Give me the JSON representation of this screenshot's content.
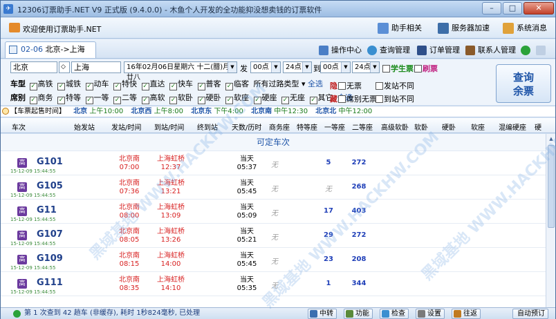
{
  "window": {
    "title": "12306订票助手.NET V9 正式版 (9.4.0.0) - 木鱼个人开发的全功能抑没想卖钱的订票软件",
    "min_label": "–",
    "max_label": "□",
    "close_label": "✕"
  },
  "toolbar": {
    "welcome": "欢迎使用订票助手.NET",
    "items": [
      "助手相关",
      "服务器加速",
      "系统消息"
    ]
  },
  "tab": {
    "date": "02-06",
    "route": "北京->上海",
    "tools": [
      "操作中心",
      "查询管理",
      "订单管理",
      "联系人管理"
    ]
  },
  "form": {
    "from": "北京",
    "swap": "◇",
    "to": "上海",
    "date_value": "16年02月06日星期六 十二(腊)月廿八",
    "depart_label": "发",
    "time_from_1": "00点",
    "time_to_1": "24点",
    "arrive_label": "到",
    "time_from_2": "00点",
    "time_to_2": "24点",
    "student": "学生票",
    "refresh": "刷票",
    "train_type_label": "车型",
    "train_types": [
      "高铁",
      "城铁",
      "动车",
      "特快",
      "直达",
      "快车",
      "普客",
      "临客"
    ],
    "pass_type": "所有过路类型",
    "select_all": "全选",
    "seat_label": "席别",
    "seats": [
      "商务",
      "特等",
      "一等",
      "二等",
      "高软",
      "软卧",
      "硬卧",
      "软座",
      "硬座",
      "无座",
      "其它"
    ],
    "hide_label": "隐",
    "no_ticket": "无票",
    "hide_label2": "藏",
    "seat_no_ticket": "席别无票",
    "depart_diff": "发站不同",
    "arrive_diff": "到站不同",
    "query_line1": "查询",
    "query_line2": "余票"
  },
  "info": {
    "label": "【车票起售时间】",
    "items": [
      {
        "station": "北京",
        "time": "上午10:00"
      },
      {
        "station": "北京西",
        "time": "上午8:00"
      },
      {
        "station": "北京东",
        "time": "下午4:00"
      },
      {
        "station": "北京南",
        "time": "中午12:30"
      },
      {
        "station": "北京北",
        "time": "中午12:00"
      }
    ]
  },
  "columns": [
    "车次",
    "始发站",
    "发站/时间",
    "到站/时间",
    "终到站",
    "天数/历时",
    "商务座",
    "特等座",
    "一等座",
    "二等座",
    "高级软卧",
    "软卧",
    "硬卧",
    "软座",
    "混编硬座",
    "硬"
  ],
  "section_label": "可定车次",
  "trains": [
    {
      "badge": "高",
      "num": "G101",
      "sale": "15-12-09 15:44:55",
      "from": "北京南",
      "dep": "07:00",
      "to": "上海虹桥",
      "arr": "12:37",
      "day": "当天",
      "dur": "05:37",
      "biz": "无",
      "biz_avail": false,
      "first": "5",
      "second": "272"
    },
    {
      "badge": "高",
      "num": "G105",
      "sale": "15-12-09 15:44:55",
      "from": "北京南",
      "dep": "07:36",
      "to": "上海虹桥",
      "arr": "13:21",
      "day": "当天",
      "dur": "05:45",
      "biz": "无",
      "biz_avail": false,
      "first": "无",
      "first_avail": false,
      "second": "268"
    },
    {
      "badge": "高",
      "num": "G11",
      "sale": "15-12-09 15:44:55",
      "from": "北京南",
      "dep": "08:00",
      "to": "上海虹桥",
      "arr": "13:09",
      "day": "当天",
      "dur": "05:09",
      "biz": "无",
      "biz_avail": false,
      "first": "17",
      "second": "403"
    },
    {
      "badge": "高",
      "num": "G107",
      "sale": "15-12-09 15:44:55",
      "from": "北京南",
      "dep": "08:05",
      "to": "上海虹桥",
      "arr": "13:26",
      "day": "当天",
      "dur": "05:21",
      "biz": "无",
      "biz_avail": false,
      "first": "29",
      "second": "272"
    },
    {
      "badge": "高",
      "num": "G109",
      "sale": "15-12-09 15:44:55",
      "from": "北京南",
      "dep": "08:15",
      "to": "上海虹桥",
      "arr": "14:00",
      "day": "当天",
      "dur": "05:45",
      "biz": "无",
      "biz_avail": false,
      "first": "23",
      "second": "208"
    },
    {
      "badge": "高",
      "num": "G111",
      "sale": "15-12-09 15:44:55",
      "from": "北京南",
      "dep": "08:35",
      "to": "上海虹桥",
      "arr": "14:10",
      "day": "当天",
      "dur": "05:35",
      "biz": "无",
      "biz_avail": false,
      "first": "1",
      "second": "344"
    }
  ],
  "status": {
    "message": "第 1 次查到 42 趟车 (非缓存), 耗时 1秒824毫秒, 已处理",
    "buttons": [
      "中转",
      "功能",
      "检查",
      "设置",
      "往返",
      "自动预订"
    ]
  },
  "watermark": "黑域基地  WWW.HACKHW.COM"
}
